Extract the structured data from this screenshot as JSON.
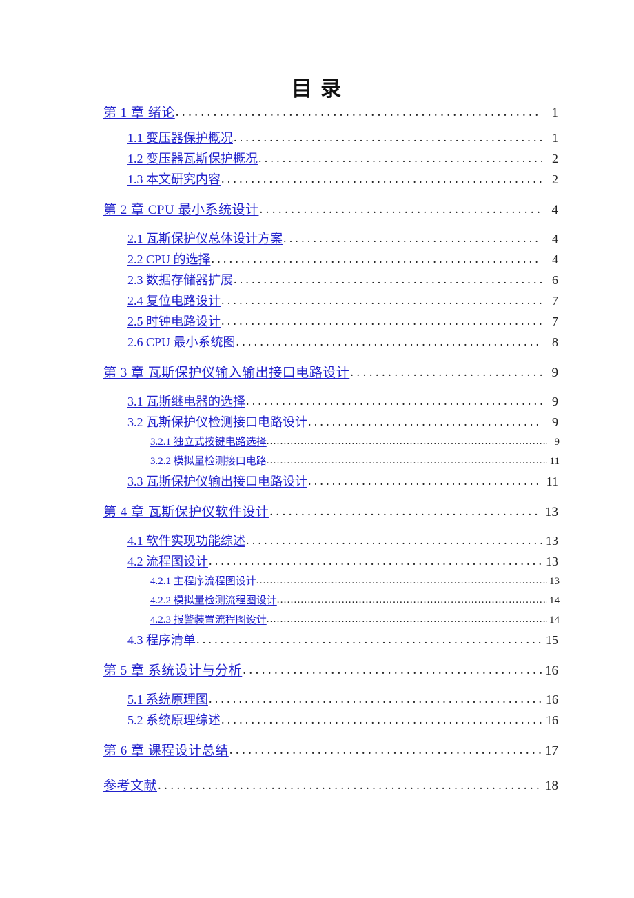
{
  "document": {
    "title": "目 录",
    "link_color": "#2222cc",
    "text_color": "#222222",
    "background": "#ffffff"
  },
  "toc": {
    "entries": [
      {
        "level": 1,
        "label": "第 1 章  绪论",
        "page": "1"
      },
      {
        "level": 2,
        "label": "1.1 变压器保护概况",
        "page": "1"
      },
      {
        "level": 2,
        "label": "1.2 变压器瓦斯保护概况",
        "page": "2"
      },
      {
        "level": 2,
        "label": "1.3 本文研究内容",
        "page": "2"
      },
      {
        "level": 1,
        "label": "第 2 章  CPU 最小系统设计",
        "page": "4"
      },
      {
        "level": 2,
        "label": "2.1 瓦斯保护仪总体设计方案",
        "page": "4"
      },
      {
        "level": 2,
        "label": "2.2 CPU 的选择",
        "page": "4"
      },
      {
        "level": 2,
        "label": "2.3 数据存储器扩展",
        "page": "6"
      },
      {
        "level": 2,
        "label": "2.4 复位电路设计",
        "page": "7"
      },
      {
        "level": 2,
        "label": "2.5 时钟电路设计",
        "page": "7"
      },
      {
        "level": 2,
        "label": "2.6 CPU 最小系统图",
        "page": "8"
      },
      {
        "level": 1,
        "label": "第 3 章  瓦斯保护仪输入输出接口电路设计",
        "page": "9"
      },
      {
        "level": 2,
        "label": "3.1 瓦斯继电器的选择",
        "page": "9"
      },
      {
        "level": 2,
        "label": "3.2 瓦斯保护仪检测接口电路设计",
        "page": "9"
      },
      {
        "level": 3,
        "label": "3.2.1  独立式按键电路选择",
        "page": "9"
      },
      {
        "level": 3,
        "label": "3.2.2  模拟量检测接口电路",
        "page": "11"
      },
      {
        "level": 2,
        "label": "3.3 瓦斯保护仪输出接口电路设计",
        "page": "11"
      },
      {
        "level": 1,
        "label": "第 4 章  瓦斯保护仪软件设计",
        "page": "13"
      },
      {
        "level": 2,
        "label": "4.1 软件实现功能综述",
        "page": "13"
      },
      {
        "level": 2,
        "label": "4.2 流程图设计",
        "page": "13"
      },
      {
        "level": 3,
        "label": "4.2.1  主程序流程图设计",
        "page": "13"
      },
      {
        "level": 3,
        "label": "4.2.2  模拟量检测流程图设计",
        "page": "14"
      },
      {
        "level": 3,
        "label": "4.2.3  报警装置流程图设计",
        "page": "14"
      },
      {
        "level": 2,
        "label": "4.3 程序清单",
        "page": "15"
      },
      {
        "level": 1,
        "label": "第 5 章  系统设计与分析",
        "page": "16"
      },
      {
        "level": 2,
        "label": "5.1 系统原理图",
        "page": "16"
      },
      {
        "level": 2,
        "label": "5.2 系统原理综述",
        "page": "16"
      },
      {
        "level": 1,
        "label": "第 6 章  课程设计总结",
        "page": "17"
      },
      {
        "level": 1,
        "label": "参考文献",
        "page": "18"
      }
    ]
  }
}
